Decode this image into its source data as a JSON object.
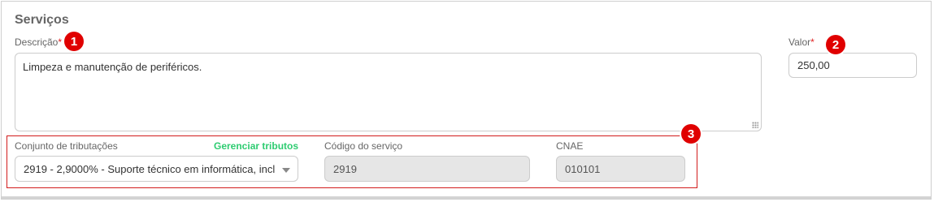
{
  "section": {
    "title": "Serviços"
  },
  "descricao": {
    "label": "Descrição",
    "required_mark": "*",
    "value": "Limpeza e manutenção de periféricos."
  },
  "valor": {
    "label": "Valor",
    "required_mark": "*",
    "value": "250,00"
  },
  "tributacao": {
    "label": "Conjunto de tributações",
    "manage_link": "Gerenciar tributos",
    "selected": "2919 - 2,9000% - Suporte técnico em informática, incl"
  },
  "codigo_servico": {
    "label": "Código do serviço",
    "value": "2919"
  },
  "cnae": {
    "label": "CNAE",
    "value": "010101"
  },
  "annotations": {
    "badge1": "1",
    "badge2": "2",
    "badge3": "3"
  },
  "colors": {
    "badge": "#e00000",
    "link": "#2ecc71",
    "highlight_border": "#d21c1c"
  }
}
